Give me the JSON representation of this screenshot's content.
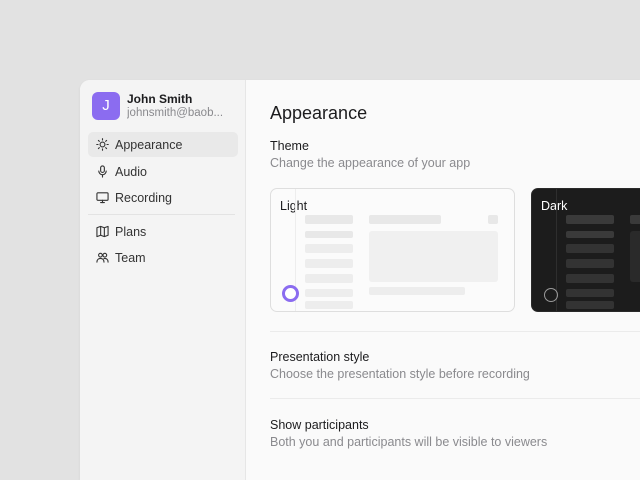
{
  "user": {
    "initial": "J",
    "name": "John Smith",
    "email": "johnsmith@baob..."
  },
  "nav": {
    "items": [
      {
        "label": "Appearance",
        "icon": "sun-icon",
        "active": true
      },
      {
        "label": "Audio",
        "icon": "microphone-icon"
      },
      {
        "label": "Recording",
        "icon": "monitor-icon"
      },
      {
        "label": "Plans",
        "icon": "map-icon"
      },
      {
        "label": "Team",
        "icon": "users-icon"
      }
    ]
  },
  "page": {
    "title": "Appearance"
  },
  "theme": {
    "title": "Theme",
    "subtitle": "Change the appearance of your app",
    "options": [
      {
        "label": "Light",
        "selected": true
      },
      {
        "label": "Dark",
        "selected": false
      }
    ]
  },
  "presentation": {
    "title": "Presentation style",
    "subtitle": "Choose the presentation style before recording"
  },
  "participants": {
    "title": "Show participants",
    "subtitle": "Both you and participants will be visible to viewers"
  },
  "colors": {
    "accent": "#8b6cf0",
    "sidebar": "#f4f4f4",
    "background": "#e2e2e2"
  }
}
